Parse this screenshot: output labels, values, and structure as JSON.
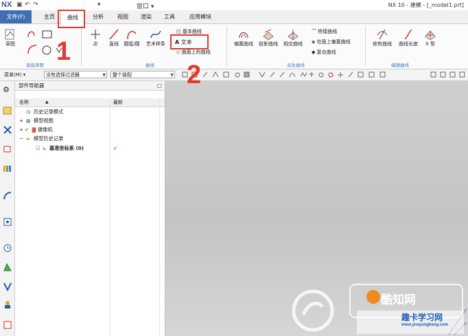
{
  "app": {
    "logo": "NX",
    "window_title": "NX 10 - 建模 - [_model1.prt]",
    "quick_access": [
      "▾",
      "窗口 ▾"
    ]
  },
  "menu": {
    "file": "文件(F)",
    "tabs": [
      "主页",
      "曲线",
      "分析",
      "视图",
      "渲染",
      "工具",
      "应用模块"
    ],
    "active_tab": "曲线"
  },
  "ribbon": {
    "sketch": {
      "label": "草图"
    },
    "direct_sketch": {
      "group": "直接草图"
    },
    "curve_buttons": [
      {
        "label": "点"
      },
      {
        "label": "直线"
      },
      {
        "label": "圆弧/圆"
      },
      {
        "label": "艺术样条"
      }
    ],
    "curve_small": [
      "基本曲线",
      "文本",
      "曲面上的曲线"
    ],
    "curve_group": "曲线",
    "derived_buttons": [
      {
        "label": "偏置曲线"
      },
      {
        "label": "投影曲线"
      },
      {
        "label": "相交曲线"
      }
    ],
    "derived_small": [
      "桥接曲线",
      "在面上偏置曲线",
      "复合曲线"
    ],
    "derived_group": "派生曲线",
    "edit_buttons": [
      {
        "label": "修剪曲线"
      },
      {
        "label": "曲线长度"
      },
      {
        "label": "X 型"
      }
    ],
    "edit_group": "编辑曲线"
  },
  "toolbar": {
    "menu_label": "菜单(M) ▾",
    "filter_value": "没有选择过滤器",
    "assembly_value": "整个装配"
  },
  "navigator": {
    "title": "部件导航器",
    "col_name": "名称",
    "col_latest": "最新",
    "items": [
      {
        "label": "历史记录模式"
      },
      {
        "label": "模型视图"
      },
      {
        "label": "摄像机"
      },
      {
        "label": "模型历史记录"
      },
      {
        "label": "基准坐标系 (0)",
        "latest": "✔"
      }
    ]
  },
  "annotations": {
    "step1": "1",
    "step2": "2"
  },
  "watermark": {
    "brand1": "酷知网",
    "brand2": "趣卡学习网",
    "url": "www.yneyangbang.com"
  },
  "colors": {
    "accent": "#3e6fb3",
    "annotation_red": "#e03a2e",
    "group_label": "#4a7bbf",
    "check_green": "#2aa52a"
  }
}
